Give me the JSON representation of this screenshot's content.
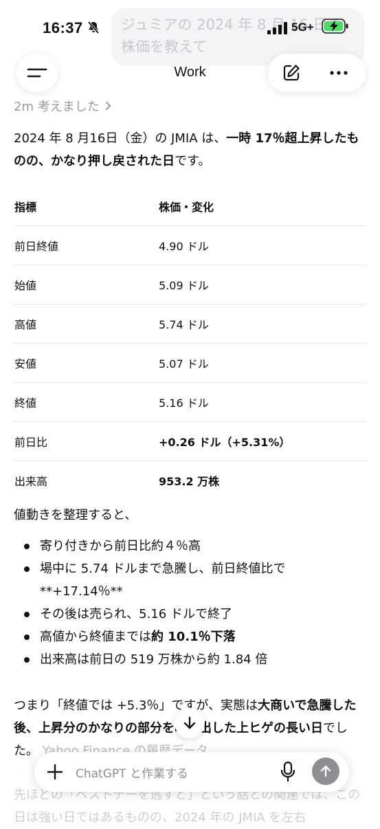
{
  "status": {
    "time": "16:37",
    "network": "5G+"
  },
  "background_bubble": "ジュミアの 2024 年 8 月 16 日の株価を教えて",
  "header": {
    "title": "Work"
  },
  "thought": "2m 考えました",
  "intro": {
    "pre": "2024 年 8 月16日（金）の JMIA は、",
    "bold": "一時 17％超上昇したものの、かなり押し戻された日",
    "post": "です。"
  },
  "table": {
    "headers": [
      "指標",
      "株価・変化"
    ],
    "rows": [
      {
        "label": "前日終値",
        "value": "4.90 ドル",
        "bold": false
      },
      {
        "label": "始値",
        "value": "5.09 ドル",
        "bold": false
      },
      {
        "label": "高値",
        "value": "5.74 ドル",
        "bold": false
      },
      {
        "label": "安値",
        "value": "5.07 ドル",
        "bold": false
      },
      {
        "label": "終値",
        "value": "5.16 ドル",
        "bold": false
      },
      {
        "label": "前日比",
        "value": "+0.26 ドル（+5.31%）",
        "bold": true
      },
      {
        "label": "出来高",
        "value": "953.2 万株",
        "bold": true
      }
    ]
  },
  "summary_lead": "値動きを整理すると、",
  "bullets": {
    "b1": "寄り付きから前日比約４％高",
    "b2": "場中に 5.74 ドルまで急騰し、前日終値比で **+17.14％**",
    "b3": "その後は売られ、5.16 ドルで終了",
    "b4_pre": "高値から終値までは",
    "b4_bold": "約 10.1％下落",
    "b5": "出来高は前日の 519 万株から約 1.84 倍"
  },
  "conclusion": {
    "p1": "つまり「終値では +5.3％」ですが、実態は",
    "b1": "大商いで急騰した後、上昇分のかなりの部分を吐き出した上ヒゲの長い日",
    "p2": "でした。",
    "faded": "Yahoo Finance の履歴データ"
  },
  "composer": {
    "placeholder": "ChatGPT と作業する"
  },
  "under_text": "先ほどの「ベストデーを逃すと」という話との関連では、この日は強い日ではあるものの、2024 年の JMIA を左右"
}
